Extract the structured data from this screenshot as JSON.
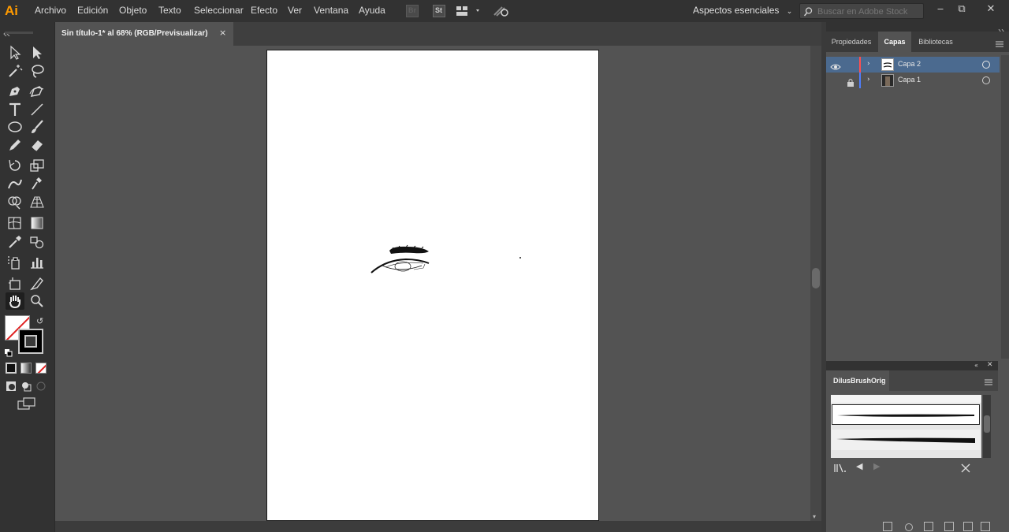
{
  "app": {
    "logo": "Ai"
  },
  "menu": [
    "Archivo",
    "Edición",
    "Objeto",
    "Texto",
    "Seleccionar",
    "Efecto",
    "Ver",
    "Ventana",
    "Ayuda"
  ],
  "menubar_icons": [
    "bridge-icon",
    "stock-icon",
    "arrange-documents-icon",
    "gpu-performance-icon"
  ],
  "menubar_icon_labels": {
    "bridge": "Br",
    "stock": "St"
  },
  "workspace": {
    "label": "Aspectos esenciales"
  },
  "search": {
    "placeholder": "Buscar en Adobe Stock"
  },
  "document": {
    "tab_label": "Sin título-1* al 68% (RGB/Previsualizar)",
    "close_glyph": "×"
  },
  "tools": [
    "selection-tool-icon",
    "direct-selection-tool-icon",
    "magic-wand-tool-icon",
    "lasso-tool-icon",
    "pen-tool-icon",
    "curvature-tool-icon",
    "type-tool-icon",
    "line-segment-tool-icon",
    "ellipse-tool-icon",
    "paintbrush-tool-icon",
    "pencil-tool-icon",
    "eraser-tool-icon",
    "rotate-tool-icon",
    "scale-tool-icon",
    "warp-tool-icon",
    "puppet-warp-tool-icon",
    "shape-builder-tool-icon",
    "perspective-grid-tool-icon",
    "mesh-tool-icon",
    "gradient-tool-icon",
    "eyedropper-tool-icon",
    "blend-tool-icon",
    "symbol-sprayer-tool-icon",
    "column-graph-tool-icon",
    "artboard-tool-icon",
    "slice-tool-icon",
    "hand-tool-icon",
    "zoom-tool-icon"
  ],
  "panels": {
    "tabs": [
      "Propiedades",
      "Capas",
      "Bibliotecas"
    ],
    "active_tab": "Capas",
    "layers": [
      {
        "name": "Capa 2",
        "color": "#ff4f4f",
        "visible": true,
        "locked": false,
        "selected": true
      },
      {
        "name": "Capa 1",
        "color": "#4f7fff",
        "visible": false,
        "locked": true,
        "selected": false
      }
    ],
    "brush_library": {
      "title": "DilusBrushOrig",
      "brush_count": 2
    }
  },
  "colors": {
    "accent_logo": "#ff9a00",
    "selected_layer": "#4b6a8f"
  }
}
